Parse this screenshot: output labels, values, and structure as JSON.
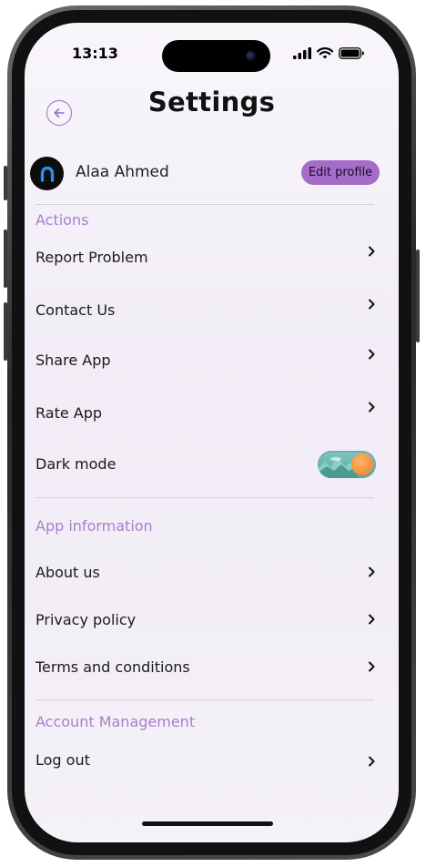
{
  "status_bar": {
    "time": "13:13"
  },
  "header": {
    "title": "Settings",
    "back_icon": "arrow-left-icon"
  },
  "profile": {
    "name": "Alaa Ahmed",
    "edit_label": "Edit profile"
  },
  "sections": {
    "actions": {
      "title": "Actions",
      "items": [
        {
          "label": "Report Problem"
        },
        {
          "label": "Contact Us"
        },
        {
          "label": "Share App"
        },
        {
          "label": "Rate App"
        },
        {
          "label": "Dark mode"
        }
      ]
    },
    "app_information": {
      "title": "App information",
      "items": [
        {
          "label": "About us"
        },
        {
          "label": "Privacy policy"
        },
        {
          "label": "Terms and conditions"
        }
      ]
    },
    "account_management": {
      "title": "Account Management",
      "items": [
        {
          "label": "Log out"
        }
      ]
    }
  },
  "dark_mode_enabled": true,
  "colors": {
    "accent": "#a56dc9",
    "section_title": "#a97fcc",
    "toggle_track": "#6bb5ad",
    "toggle_knob": "#f28d3c"
  }
}
